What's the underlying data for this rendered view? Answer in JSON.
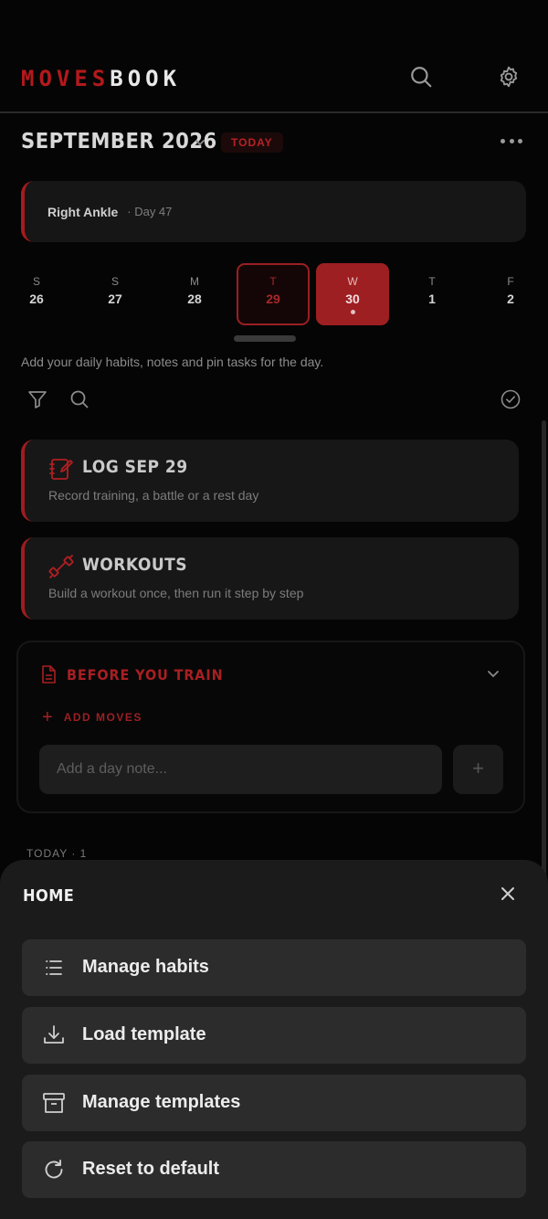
{
  "header": {
    "brand_part1": "MOVES",
    "brand_part2": "BOOK",
    "search_icon": "search-icon",
    "settings_icon": "gear-icon"
  },
  "calendar": {
    "month_label": "SEPTEMBER 2026",
    "today_label": "TODAY",
    "injury": {
      "name": "Right Ankle",
      "day": "· Day 47"
    },
    "days": [
      {
        "letter": "S",
        "num": "26"
      },
      {
        "letter": "S",
        "num": "27"
      },
      {
        "letter": "M",
        "num": "28"
      },
      {
        "letter": "T",
        "num": "29",
        "state": "selected"
      },
      {
        "letter": "W",
        "num": "30",
        "state": "current",
        "has_entry": true
      },
      {
        "letter": "T",
        "num": "1"
      },
      {
        "letter": "F",
        "num": "2"
      }
    ],
    "hint": "Add your daily habits, notes and pin tasks for the day."
  },
  "cards": [
    {
      "title": "LOG SEP 29",
      "subtitle": "Record training, a battle or a rest day",
      "icon": "edit-notebook-icon"
    },
    {
      "title": "WORKOUTS",
      "subtitle": "Build a workout once, then run it step by step",
      "icon": "dumbbell-icon"
    }
  ],
  "before_train": {
    "title": "BEFORE YOU TRAIN",
    "add_moves": "ADD MOVES",
    "note_placeholder": "Add a day note...",
    "add_button": "+"
  },
  "today_count": "TODAY · 1",
  "sheet": {
    "title": "HOME",
    "items": [
      {
        "label": "Manage habits",
        "icon": "list-icon"
      },
      {
        "label": "Load template",
        "icon": "download-icon"
      },
      {
        "label": "Manage templates",
        "icon": "archive-icon"
      },
      {
        "label": "Reset to default",
        "icon": "refresh-icon"
      }
    ]
  },
  "colors": {
    "accent": "#a51b1e",
    "background": "#050505",
    "card": "#171717",
    "sheet": "#1b1b1b"
  }
}
